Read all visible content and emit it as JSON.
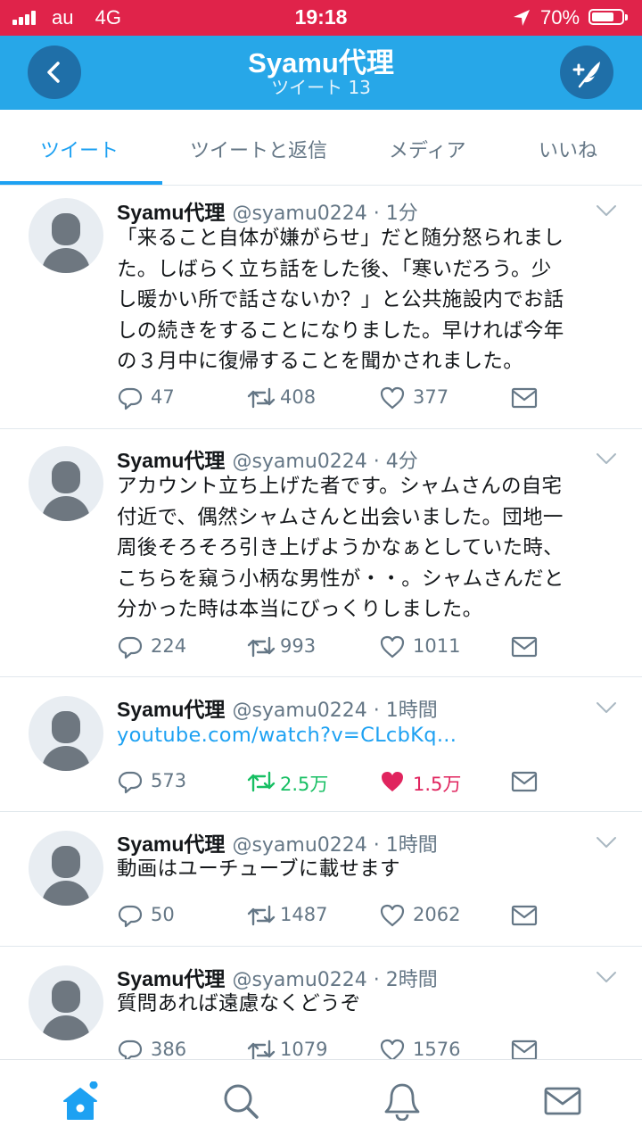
{
  "status_bar": {
    "carrier": "au",
    "network": "4G",
    "time": "19:18",
    "battery_percent": "70%",
    "battery_level": 0.7,
    "bar_color": "#e0234a"
  },
  "header": {
    "title": "Syamu代理",
    "subtitle": "ツイート 13",
    "back_icon": "chevron-left-icon",
    "compose_icon": "compose-tweet-icon",
    "color": "#27a7e8"
  },
  "tabs": [
    {
      "label": "ツイート",
      "active": true
    },
    {
      "label": "ツイートと返信",
      "active": false
    },
    {
      "label": "メディア",
      "active": false
    },
    {
      "label": "いいね",
      "active": false
    }
  ],
  "tweets": [
    {
      "name": "Syamu代理",
      "meta": "@syamu0224 · 1分",
      "lines": [
        "「来ること自体が嫌がらせ」だと随分怒られまし",
        "た。しばらく立ち話をした後、「寒いだろう。少",
        "し暖かい所で話さないか？」と公共施設内でお話",
        "しの続きをすることになりました。早ければ今年",
        "の３月中に復帰することを聞かされました。"
      ],
      "replies": "47",
      "retweets": "408",
      "likes": "377",
      "retweeted": false,
      "liked": false
    },
    {
      "name": "Syamu代理",
      "meta": "@syamu0224 · 4分",
      "lines": [
        "アカウント立ち上げた者です。シャムさんの自宅",
        "付近で、偶然シャムさんと出会いました。団地一",
        "周後そろそろ引き上げようかなぁとしていた時、",
        "こちらを窺う小柄な男性が・・。シャムさんだと",
        "分かった時は本当にびっくりしました。"
      ],
      "replies": "224",
      "retweets": "993",
      "likes": "1011",
      "retweeted": false,
      "liked": false
    },
    {
      "name": "Syamu代理",
      "meta": "@syamu0224 · 1時間",
      "link": "youtube.com/watch?v=CLcbKq...",
      "replies": "573",
      "retweets": "2.5万",
      "likes": "1.5万",
      "retweeted": true,
      "liked": true
    },
    {
      "name": "Syamu代理",
      "meta": "@syamu0224 · 1時間",
      "lines": [
        "動画はユーチューブに載せます"
      ],
      "replies": "50",
      "retweets": "1487",
      "likes": "2062",
      "retweeted": false,
      "liked": false
    },
    {
      "name": "Syamu代理",
      "meta": "@syamu0224 · 2時間",
      "lines": [
        "質問あれば遠慮なくどうぞ"
      ],
      "replies": "386",
      "retweets": "1079",
      "likes": "1576",
      "retweeted": false,
      "liked": false
    }
  ],
  "bottom_nav": [
    {
      "icon": "home-icon",
      "active": true,
      "has_notification_dot": true
    },
    {
      "icon": "search-icon",
      "active": false
    },
    {
      "icon": "bell-icon",
      "active": false
    },
    {
      "icon": "mail-icon",
      "active": false
    }
  ],
  "colors": {
    "accent": "#1da1f2",
    "retweet_active": "#17bf63",
    "like_active": "#e0245e",
    "secondary_text": "#657786"
  }
}
